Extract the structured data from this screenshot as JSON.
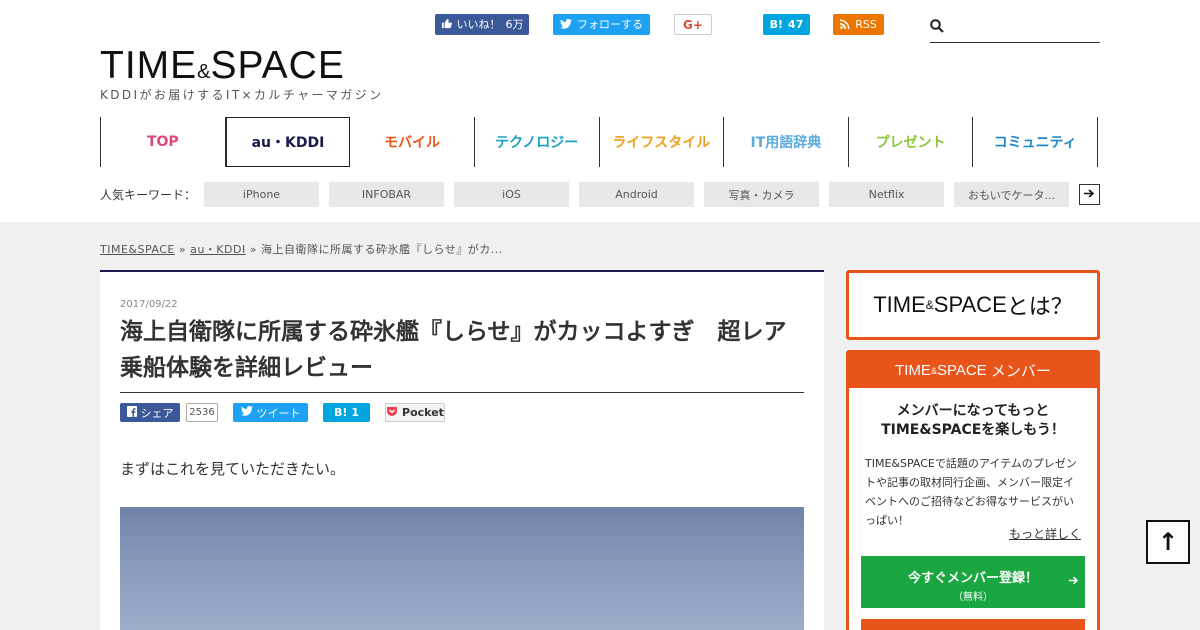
{
  "header": {
    "social": {
      "like_label": "いいね！",
      "like_count": "6万",
      "follow_label": "フォローする",
      "gplus_label": "G+",
      "hatena_label": "B!",
      "hatena_count": "47",
      "rss_label": "RSS"
    },
    "search": {
      "placeholder": ""
    },
    "logo": {
      "left": "TIME",
      "amp": "&",
      "right": "SPACE"
    },
    "tagline": "KDDIがお届けするIT×カルチャーマガジン"
  },
  "nav": {
    "items": [
      {
        "label": "TOP",
        "color": "#e0457b"
      },
      {
        "label": "au・KDDI",
        "color": "#1a1a4e"
      },
      {
        "label": "モバイル",
        "color": "#e8541a"
      },
      {
        "label": "テクノロジー",
        "color": "#1a9fc6"
      },
      {
        "label": "ライフスタイル",
        "color": "#f0a01e"
      },
      {
        "label": "IT用語辞典",
        "color": "#5aaadc"
      },
      {
        "label": "プレゼント",
        "color": "#8cc63f"
      },
      {
        "label": "コミュニティ",
        "color": "#1e88c8"
      }
    ]
  },
  "keywords": {
    "label": "人気キーワード：",
    "tags": [
      "iPhone",
      "INFOBAR",
      "iOS",
      "Android",
      "写真・カメラ",
      "Netflix",
      "おもいでケータ..."
    ],
    "more_icon": "arrow-right-icon"
  },
  "breadcrumb": {
    "home": "TIME&SPACE",
    "sep": "»",
    "category": "au・KDDI",
    "current": "海上自衛隊に所属する砕氷艦『しらせ』がカ..."
  },
  "article": {
    "date": "2017/09/22",
    "title": "海上自衛隊に所属する砕氷艦『しらせ』がカッコよすぎ　超レア乗船体験を詳細レビュー",
    "share": {
      "fb_label": "シェア",
      "fb_count": "2536",
      "tw_label": "ツイート",
      "hatena_label": "B!",
      "hatena_count": "1",
      "pocket_label": "Pocket"
    },
    "lead": "まずはこれを見ていただきたい。"
  },
  "sidebar": {
    "about": {
      "left": "TIME",
      "amp": "&",
      "right": "SPACE",
      "suffix": "とは？"
    },
    "member": {
      "head_left": "TIME",
      "head_amp": "&",
      "head_right": "SPACE",
      "head_suffix": "メンバー",
      "lead_line1": "メンバーになってもっと",
      "lead_line2": "TIME&SPACEを楽しもう！",
      "desc": "TIME&SPACEで話題のアイテムのプレゼントや記事の取材同行企画、メンバー限定イベントへのご招待などお得なサービスがいっぱい！",
      "more": "もっと詳しく",
      "signup_label": "今すぐメンバー登録！",
      "signup_sub": "（無料）"
    }
  },
  "back_to_top": "↑",
  "colors": {
    "accent_orange": "#e8541a",
    "signup_green": "#1aa640",
    "navy": "#1a1a4e",
    "facebook": "#3b5998",
    "twitter": "#1da1f2",
    "hatena": "#00a4de",
    "rss": "#ee7600"
  }
}
